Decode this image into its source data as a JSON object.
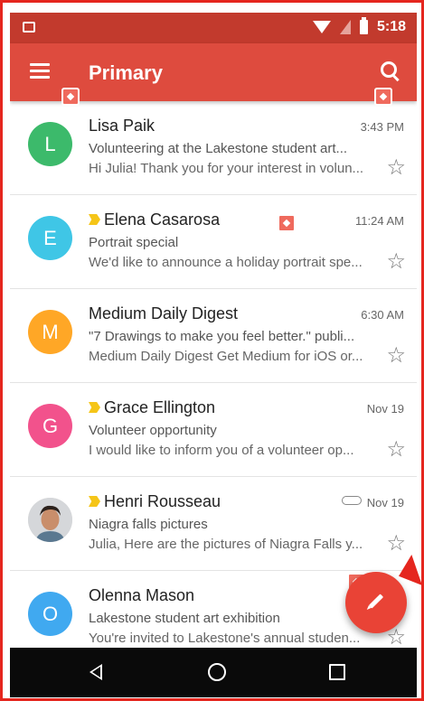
{
  "status_bar": {
    "time": "5:18"
  },
  "app_bar": {
    "title": "Primary"
  },
  "emails": [
    {
      "avatar_letter": "L",
      "avatar_color": "#3cba6b",
      "sender": "Lisa Paik",
      "important": false,
      "time": "3:43 PM",
      "subject": "Volunteering at the Lakestone student art...",
      "snippet": "Hi Julia! Thank you for your interest in volun...",
      "attachment": false
    },
    {
      "avatar_letter": "E",
      "avatar_color": "#3fc6e6",
      "sender": "Elena Casarosa",
      "important": true,
      "time": "11:24 AM",
      "subject": "Portrait special",
      "snippet": "We'd like to announce a holiday portrait spe...",
      "attachment": false
    },
    {
      "avatar_letter": "M",
      "avatar_color": "#ffa726",
      "sender": "Medium Daily Digest",
      "important": false,
      "time": "6:30 AM",
      "subject": "\"7 Drawings to make you feel better.\" publi...",
      "snippet": "Medium Daily Digest Get Medium for iOS or...",
      "attachment": false
    },
    {
      "avatar_letter": "G",
      "avatar_color": "#f2528c",
      "sender": "Grace Ellington",
      "important": true,
      "time": "Nov 19",
      "subject": "Volunteer opportunity",
      "snippet": "I would like to inform you of a volunteer op...",
      "attachment": false
    },
    {
      "avatar_letter": "",
      "avatar_color": "#d9d4cf",
      "sender": "Henri Rousseau",
      "important": true,
      "time": "Nov 19",
      "subject": "Niagra falls pictures",
      "snippet": "Julia, Here are the pictures of Niagra Falls y...",
      "attachment": true
    },
    {
      "avatar_letter": "O",
      "avatar_color": "#40a9f0",
      "sender": "Olenna Mason",
      "important": false,
      "time": "",
      "subject": "Lakestone student art exhibition",
      "snippet": "You're invited to Lakestone's annual studen...",
      "attachment": false
    }
  ],
  "icons": {
    "menu": "menu-icon",
    "search": "search-icon",
    "star": "star-outline-icon",
    "compose": "pencil-icon",
    "attachment": "paperclip-icon",
    "important": "important-marker-icon"
  }
}
